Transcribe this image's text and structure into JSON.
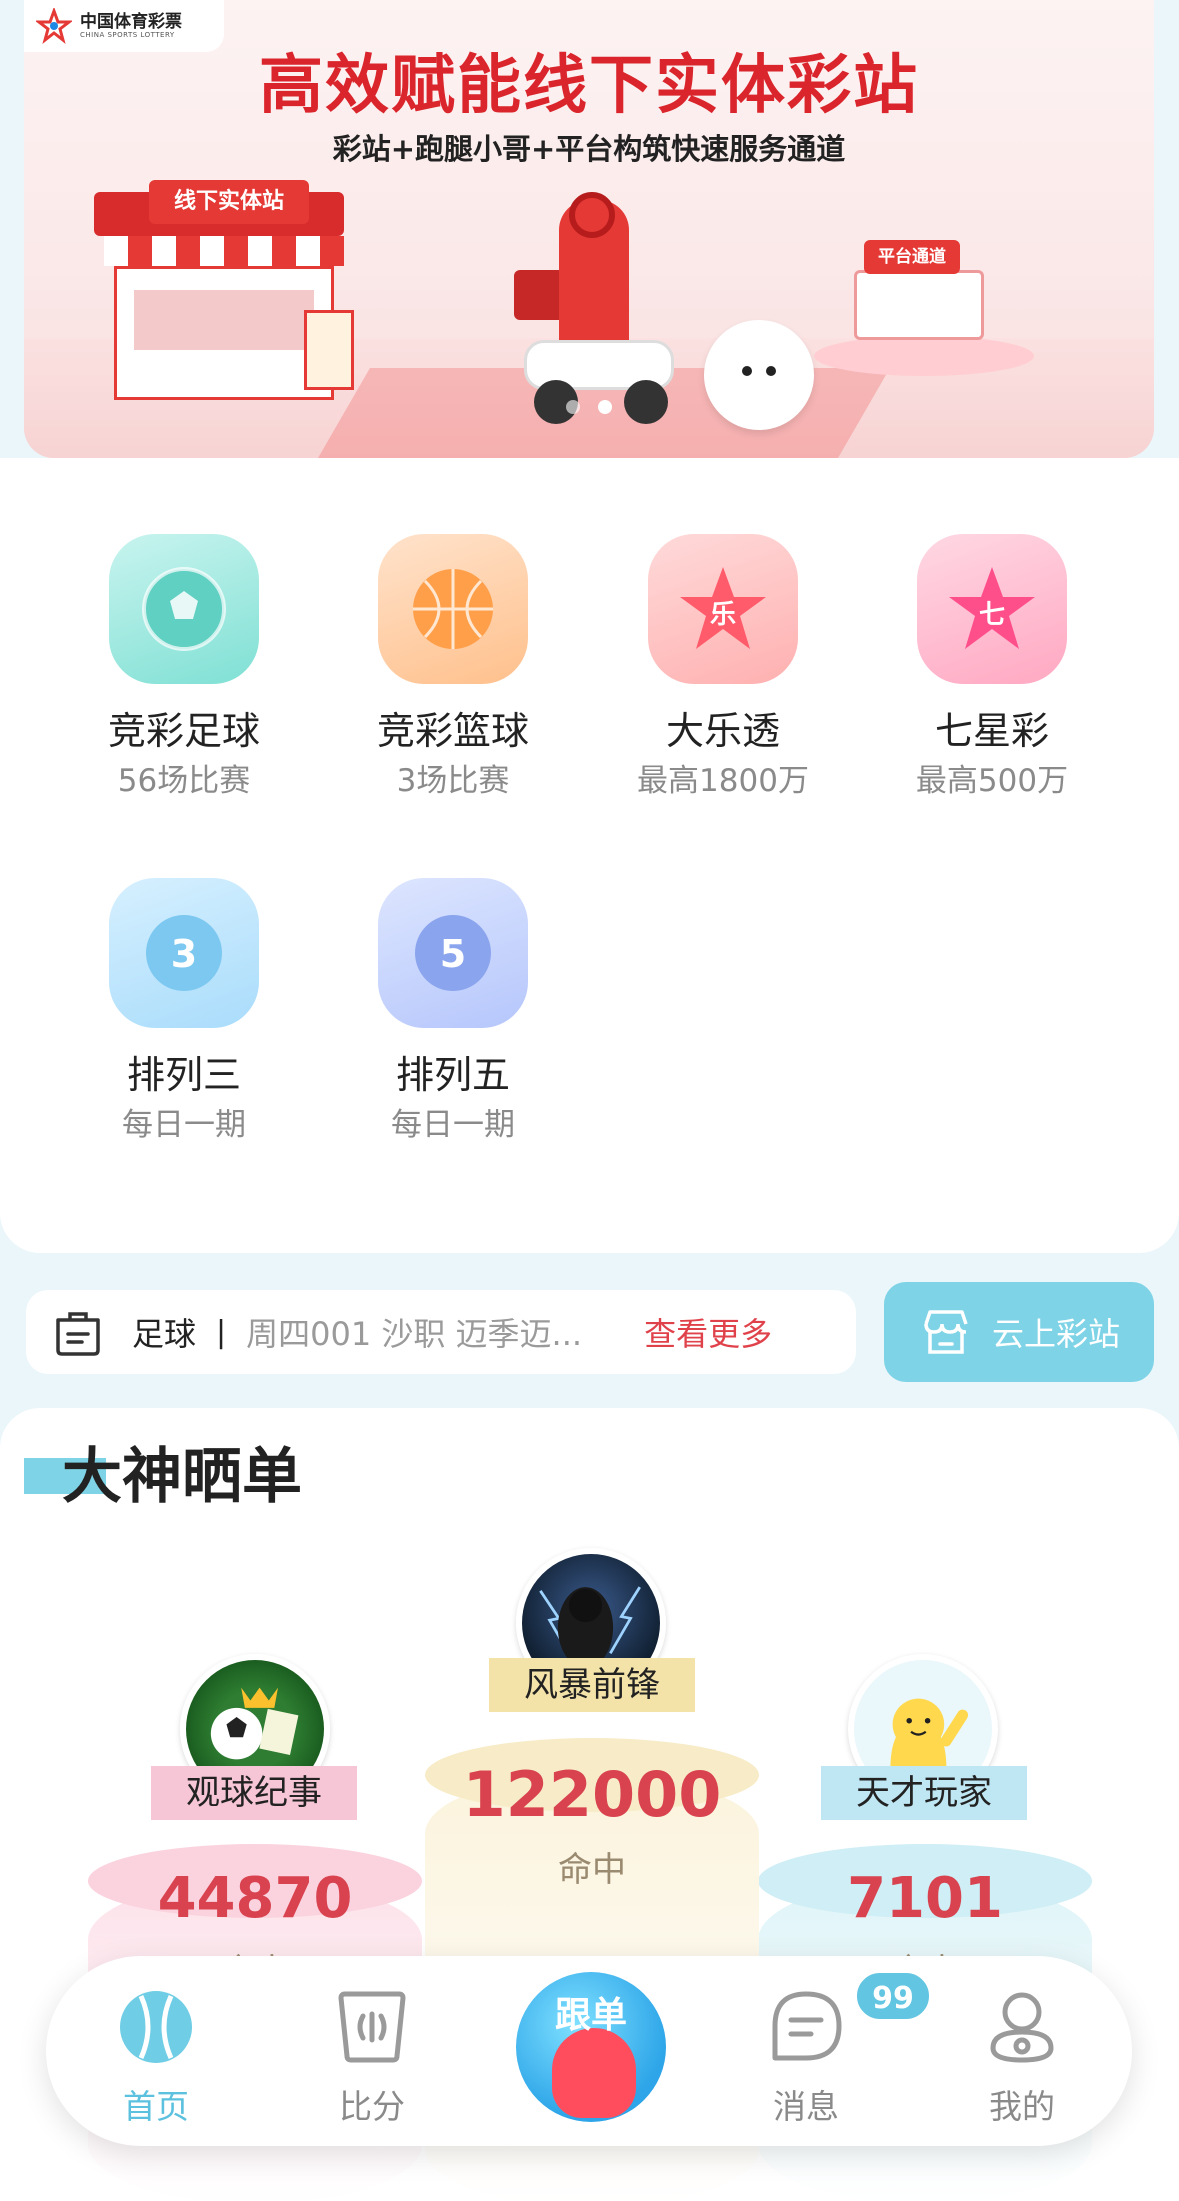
{
  "banner": {
    "logo_text": "中国体育彩票",
    "logo_sub": "CHINA SPORTS LOTTERY",
    "headline": "高效赋能线下实体彩站",
    "subline": "彩站+跑腿小哥+平台构筑快速服务通道",
    "store_sign": "线下实体站",
    "platform_label": "平台通道",
    "page_count": 2,
    "active_page": 2
  },
  "games": [
    {
      "name": "竞彩足球",
      "sub": "56场比赛",
      "icon": "football-icon"
    },
    {
      "name": "竞彩篮球",
      "sub": "3场比赛",
      "icon": "basketball-icon"
    },
    {
      "name": "大乐透",
      "sub": "最高1800万",
      "icon": "star-le-icon"
    },
    {
      "name": "七星彩",
      "sub": "最高500万",
      "icon": "star-qi-icon"
    },
    {
      "name": "排列三",
      "sub": "每日一期",
      "icon": "ball-3-icon"
    },
    {
      "name": "排列五",
      "sub": "每日一期",
      "icon": "ball-5-icon"
    }
  ],
  "notice": {
    "category": "足球",
    "separator": "|",
    "text": "周四001 沙职 迈季迈...",
    "more": "查看更多"
  },
  "cloud_station": {
    "label": "云上彩站"
  },
  "ranking": {
    "title": "大神晒单",
    "hit_label": "命中",
    "entries": [
      {
        "rank": 2,
        "name": "观球纪事",
        "score": "44870",
        "plate_color": "#f6c6d6"
      },
      {
        "rank": 1,
        "name": "风暴前锋",
        "score": "122000",
        "plate_color": "#f3e3a8"
      },
      {
        "rank": 3,
        "name": "天才玩家",
        "score": "7101",
        "plate_color": "#bfe7f3"
      }
    ]
  },
  "nav": {
    "items": [
      {
        "label": "首页",
        "icon": "home-ball-icon",
        "active": true
      },
      {
        "label": "比分",
        "icon": "score-icon",
        "active": false
      },
      {
        "label": "跟单",
        "icon": "follow-icon",
        "active": false
      },
      {
        "label": "消息",
        "icon": "message-icon",
        "active": false
      },
      {
        "label": "我的",
        "icon": "profile-icon",
        "active": false
      }
    ],
    "message_badge": "99"
  },
  "colors": {
    "accent": "#5cc1df",
    "brand_red": "#d9252b",
    "score_red": "#d8434f"
  }
}
